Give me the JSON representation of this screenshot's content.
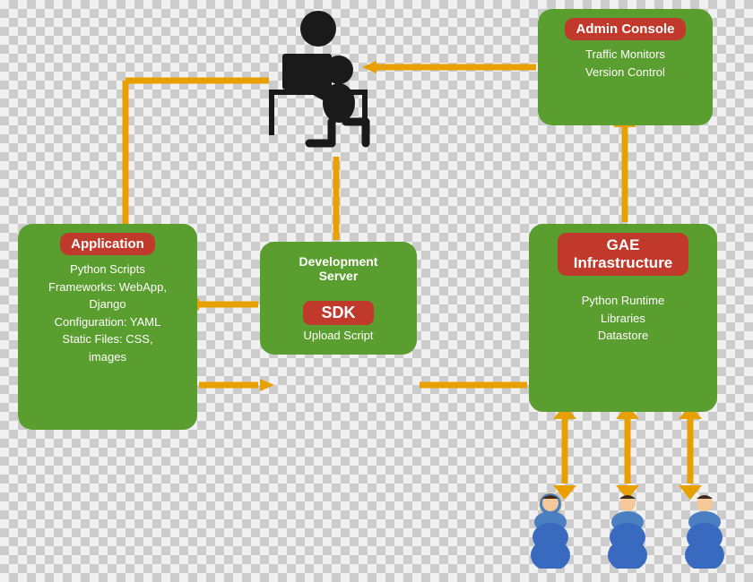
{
  "adminConsole": {
    "header": "Admin Console",
    "line1": "Traffic Monitors",
    "line2": "Version Control"
  },
  "application": {
    "header": "Application",
    "line1": "Python Scripts",
    "line2": "Frameworks: WebApp,",
    "line3": "Django",
    "line4": "Configuration: YAML",
    "line5": "Static Files: CSS,",
    "line6": "images"
  },
  "devServer": {
    "label": "Development",
    "label2": "Server"
  },
  "sdk": {
    "label": "SDK"
  },
  "uploadScript": {
    "label": "Upload Script"
  },
  "gaeInfra": {
    "header": "GAE",
    "header2": "Infrastructure",
    "line1": "Python Runtime",
    "line2": "Libraries",
    "line3": "Datastore"
  },
  "colors": {
    "green": "#5a9e2f",
    "red": "#c0392b",
    "orange": "#e8a000",
    "darkGreen": "#4a8a20"
  }
}
